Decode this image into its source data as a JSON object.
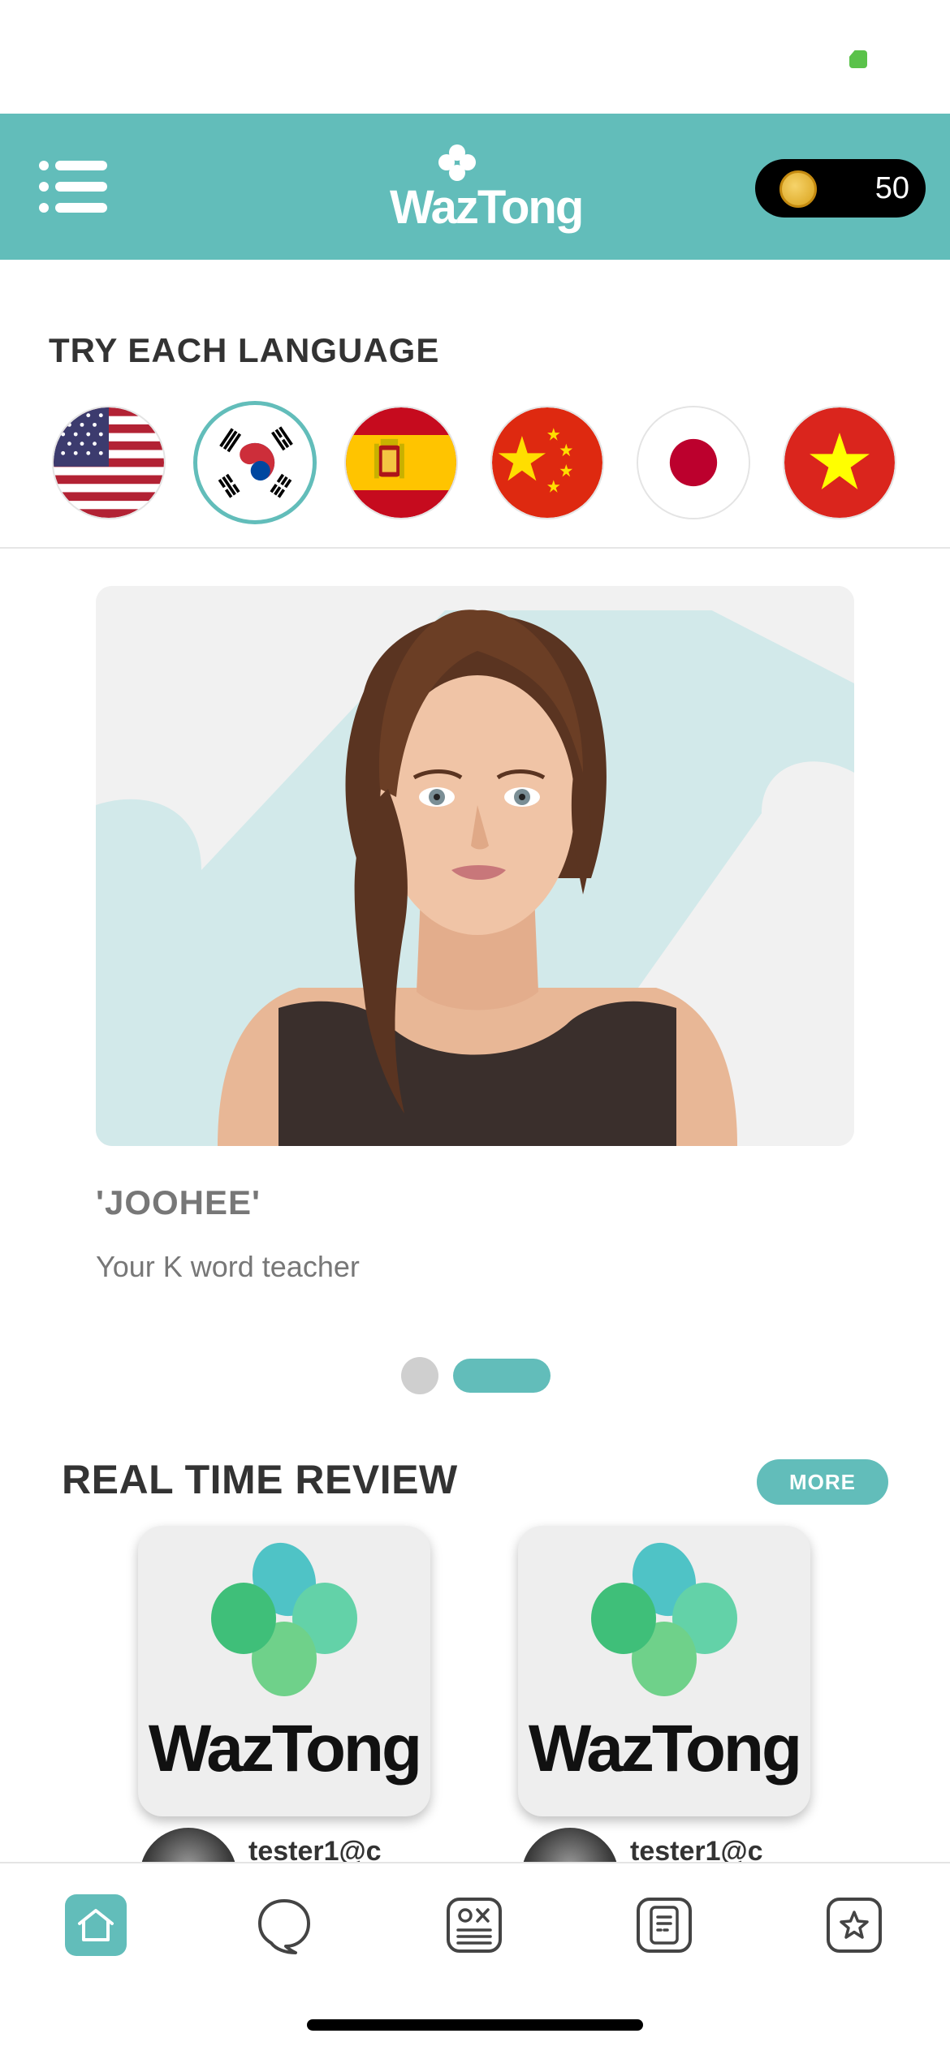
{
  "header": {
    "menu_icon": "list-menu-icon",
    "logo_text": "WazTong",
    "coin_icon": "gold-coin-icon",
    "coin_count": "50"
  },
  "languages": {
    "title": "TRY EACH LANGUAGE",
    "items": [
      {
        "flag": "united-states-flag-icon",
        "selected": false
      },
      {
        "flag": "south-korea-flag-icon",
        "selected": true
      },
      {
        "flag": "spain-flag-icon",
        "selected": false
      },
      {
        "flag": "china-flag-icon",
        "selected": false
      },
      {
        "flag": "japan-flag-icon",
        "selected": false
      },
      {
        "flag": "vietnam-flag-icon",
        "selected": false
      }
    ]
  },
  "teacher": {
    "name": "'JOOHEE'",
    "subtitle": "Your K word teacher",
    "carousel_pages": 2,
    "carousel_active_page": 2
  },
  "review": {
    "title": "REAL TIME REVIEW",
    "more_label": "MORE",
    "cards": [
      {
        "logo_text": "WazTong",
        "reviewer": "tester1@c"
      },
      {
        "logo_text": "WazTong",
        "reviewer": "tester1@c"
      }
    ]
  },
  "tabs": [
    {
      "icon": "home-icon",
      "active": true
    },
    {
      "icon": "chat-bubble-icon",
      "active": false
    },
    {
      "icon": "quiz-ox-icon",
      "active": false
    },
    {
      "icon": "notes-icon",
      "active": false
    },
    {
      "icon": "star-icon",
      "active": false
    }
  ],
  "colors": {
    "accent": "#62bdba",
    "header_bg": "#62bdba",
    "coin_pill_bg": "#000000",
    "text_dark": "#333333",
    "text_muted": "#777777"
  }
}
